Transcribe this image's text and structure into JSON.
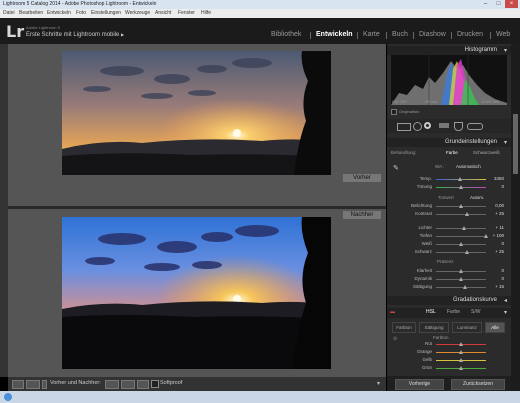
{
  "window": {
    "title": "Lightroom 5 Catalog 2014 - Adobe Photoshop Lightroom - Entwickeln",
    "controls": [
      "–",
      "□",
      "×"
    ]
  },
  "menu": [
    "Datei",
    "Bearbeiten",
    "Entwickeln",
    "Foto",
    "Einstellungen",
    "Werkzeuge",
    "Ansicht",
    "Fenster",
    "Hilfe"
  ],
  "identity": {
    "logo": "Lr",
    "line1": "Adobe Lightroom 5",
    "line2": "Erste Schritte mit Lightroom mobile",
    "arrow": "▶"
  },
  "modules": [
    {
      "label": "Bibliothek",
      "active": false
    },
    {
      "label": "Entwickeln",
      "active": true
    },
    {
      "label": "Karte",
      "active": false
    },
    {
      "label": "Buch",
      "active": false
    },
    {
      "label": "Diashow",
      "active": false
    },
    {
      "label": "Drucken",
      "active": false
    },
    {
      "label": "Web",
      "active": false
    }
  ],
  "compare": {
    "before_label": "Vorher",
    "after_label": "Nachher"
  },
  "toolbar": {
    "before_after_label": "Vorher und Nachher:",
    "softproof_label": "Softproof"
  },
  "histogram": {
    "title": "Histogramm",
    "info": [
      "ISO 100",
      "29 mm",
      "f / 9,0",
      "1/160 Sek."
    ],
    "original_photo": "Originalfoto"
  },
  "basic": {
    "title": "Grundeinstellungen",
    "behandlung": "Behandlung:",
    "farbe": "Farbe",
    "sw": "Schwarzweiß",
    "wb": "WA :",
    "wb_value": "Automatisch",
    "tone_label": "Tonwert",
    "tone_auto": "Autom.",
    "presence_label": "Präsenz",
    "rows": [
      {
        "label": "Temp.",
        "value": "3450",
        "pos": 0.47
      },
      {
        "label": "Tönung",
        "value": "0",
        "pos": 0.5
      },
      {
        "label": "Belichtung",
        "value": "0,00",
        "pos": 0.5
      },
      {
        "label": "Kontrast",
        "value": "+ 25",
        "pos": 0.62
      },
      {
        "label": "Lichter",
        "value": "+ 11",
        "pos": 0.55
      },
      {
        "label": "Tiefen",
        "value": "+ 100",
        "pos": 1.0
      },
      {
        "label": "Weiß",
        "value": "0",
        "pos": 0.5
      },
      {
        "label": "Schwarz",
        "value": "+ 25",
        "pos": 0.62
      },
      {
        "label": "Klarheit",
        "value": "0",
        "pos": 0.5
      },
      {
        "label": "Dynamik",
        "value": "0",
        "pos": 0.5
      },
      {
        "label": "Sättigung",
        "value": "+ 15",
        "pos": 0.57
      }
    ]
  },
  "tone_curve": {
    "title": "Gradationskurve"
  },
  "hsl": {
    "modes": [
      {
        "label": "HSL",
        "active": true
      },
      {
        "label": "Farbe",
        "active": false
      },
      {
        "label": "S/W",
        "active": false
      }
    ],
    "tabs": [
      {
        "label": "Farbton",
        "active": false
      },
      {
        "label": "Sättigung",
        "active": false
      },
      {
        "label": "Luminanz",
        "active": false
      },
      {
        "label": "Alle",
        "active": true
      }
    ],
    "section": "Farbton",
    "rows": [
      {
        "label": "Rot",
        "color": "#d23b3b"
      },
      {
        "label": "Orange",
        "color": "#e08a2c"
      },
      {
        "label": "Gelb",
        "color": "#d6c43a"
      },
      {
        "label": "Grün",
        "color": "#4caa3d"
      }
    ]
  },
  "actions": {
    "previous": "Vorherige",
    "reset": "Zurücksetzen"
  }
}
